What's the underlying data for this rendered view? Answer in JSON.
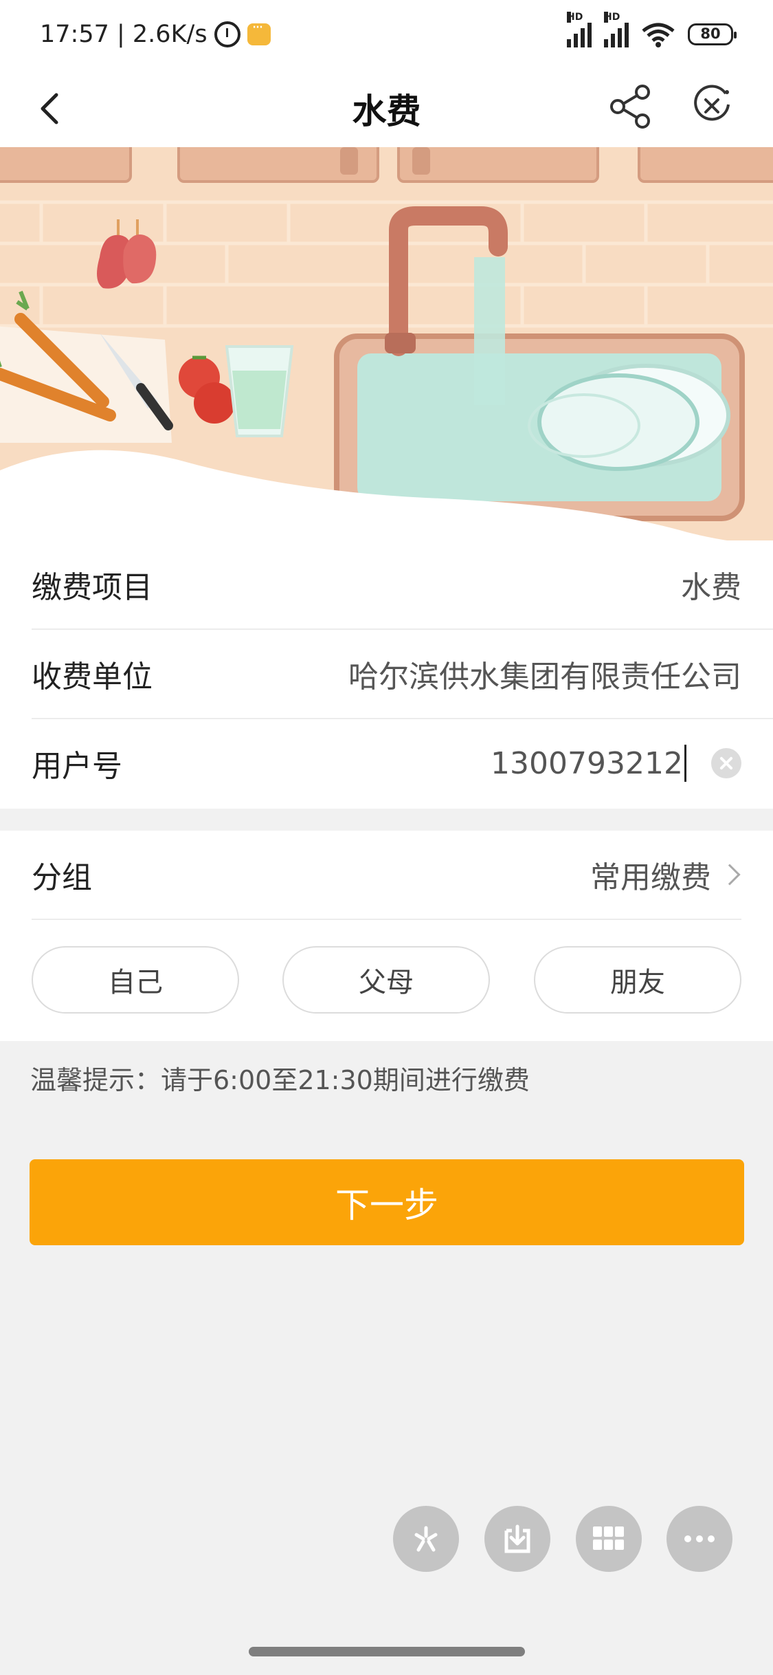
{
  "status_bar": {
    "time_speed": "17:57 | 2.6K/s",
    "signal1_label": "HD",
    "signal2_label": "HD",
    "battery": "80"
  },
  "nav": {
    "title": "水费",
    "back_icon": "chevron-left-icon",
    "share_icon": "share-icon",
    "close_icon": "close-circle-icon"
  },
  "form": {
    "item_label": "缴费项目",
    "item_value": "水费",
    "company_label": "收费单位",
    "company_value": "哈尔滨供水集团有限责任公司",
    "account_label": "用户号",
    "account_value": "1300793212",
    "group_label": "分组",
    "group_value": "常用缴费"
  },
  "group_options": [
    "自己",
    "父母",
    "朋友"
  ],
  "tip": "温馨提示：请于6:00至21:30期间进行缴费",
  "next_button": "下一步",
  "floating_actions": [
    "pinwheel-icon",
    "download-icon",
    "grid-icon",
    "more-icon"
  ],
  "colors": {
    "accent": "#fba409",
    "background": "#f1f1f1"
  }
}
